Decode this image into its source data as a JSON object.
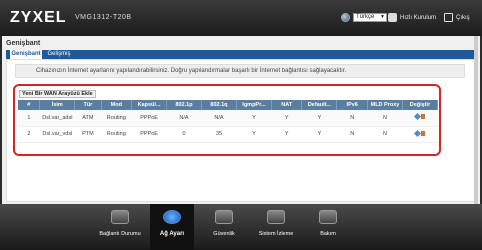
{
  "header": {
    "logo": "ZYXEL",
    "model": "VMG1312-T20B",
    "language": "Türkçe",
    "wizard_label": "Hızlı Kurulum",
    "exit_label": "Çıkış"
  },
  "page": {
    "title": "Genişbant",
    "tabs": [
      {
        "label": "Genişbant"
      },
      {
        "label": "Gelişmiş"
      }
    ],
    "info_text": "Cihazınızın İnternet ayarlarını yapılandırabilirsiniz. Doğru yapılandırmalar başarlı bir İnternet bağlantısı sağlayacaktır.",
    "add_button": "Yeni Bir WAN Arayüzü Ekle"
  },
  "table": {
    "headers": [
      "#",
      "İsim",
      "Tür",
      "Mod",
      "Kapsül...",
      "802.1p",
      "802.1q",
      "IgmpPr...",
      "NAT",
      "Default...",
      "IPv6",
      "MLD Proxy",
      "Değiştir"
    ],
    "rows": [
      {
        "num": "1",
        "name": "Dsl.var_adsl",
        "type": "ATM",
        "mode": "Routing",
        "encap": "PPPoE",
        "p8021p": "N/A",
        "p8021q": "N/A",
        "igmp": "Y",
        "nat": "Y",
        "default": "Y",
        "ipv6": "N",
        "mld": "N"
      },
      {
        "num": "2",
        "name": "Dsl.var_vdsl",
        "type": "PTM",
        "mode": "Routing",
        "encap": "PPPoE",
        "p8021p": "0",
        "p8021q": "35",
        "igmp": "Y",
        "nat": "Y",
        "default": "Y",
        "ipv6": "N",
        "mld": "N"
      }
    ]
  },
  "nav": {
    "items": [
      {
        "label": "Bağlantı Durumu"
      },
      {
        "label": "Ağ Ayarı"
      },
      {
        "label": "Güvenlik"
      },
      {
        "label": "Sistem İzleme"
      },
      {
        "label": "Bakım"
      }
    ]
  }
}
